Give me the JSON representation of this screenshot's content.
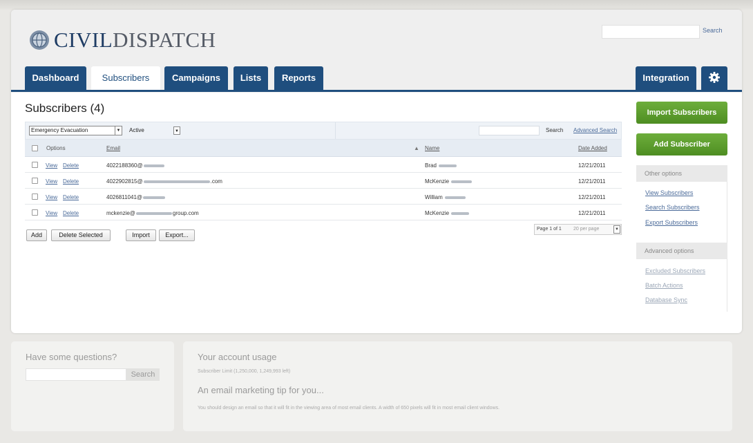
{
  "app": {
    "logo_bold": "CIVIL",
    "logo_light": "DISPATCH",
    "search_button": "Search"
  },
  "nav": {
    "tabs": [
      {
        "label": "Dashboard"
      },
      {
        "label": "Subscribers",
        "active": true
      },
      {
        "label": "Campaigns"
      },
      {
        "label": "Lists"
      },
      {
        "label": "Reports"
      }
    ],
    "integration": "Integration",
    "settings_icon": "gear-icon"
  },
  "main": {
    "title": "Subscribers (4)",
    "filter": {
      "list_value": "Emergency Evacuation",
      "status_value": "Active",
      "search_button": "Search",
      "advanced_search": "Advanced Search"
    },
    "table": {
      "headers": {
        "options": "Options",
        "email": "Email",
        "name": "Name",
        "date": "Date Added"
      },
      "view": "View",
      "delete": "Delete",
      "rows": [
        {
          "email_prefix": "4022188360@",
          "email_suffix": "",
          "name": "Brad",
          "date": "12/21/2011"
        },
        {
          "email_prefix": "4022902815@",
          "email_suffix": ".com",
          "name": "McKenzie",
          "date": "12/21/2011"
        },
        {
          "email_prefix": "4026811041@",
          "email_suffix": "",
          "name": "William",
          "date": "12/21/2011"
        },
        {
          "email_prefix": "mckenzie@",
          "email_suffix": "group.com",
          "name": "McKenzie",
          "date": "12/21/2011"
        }
      ]
    },
    "actions": {
      "add": "Add",
      "delete_selected": "Delete Selected",
      "import": "Import",
      "export": "Export..."
    },
    "pager": {
      "page": "Page 1 of 1",
      "per_page": "20 per page"
    }
  },
  "sidebar": {
    "import_button": "Import Subscribers",
    "add_button": "Add Subscriber",
    "other_options": "Other options",
    "other_links": [
      "View Subscribers",
      "Search Subscribers",
      "Export Subscribers"
    ],
    "advanced_options": "Advanced options",
    "advanced_links": [
      "Excluded Subscribers",
      "Batch Actions",
      "Database Sync"
    ]
  },
  "footer": {
    "questions_title": "Have some questions?",
    "questions_button": "Search",
    "usage_title": "Your account usage",
    "usage_text": "Subscriber Limit (1,250,000, 1,249,993 left)",
    "tip_title": "An email marketing tip for you...",
    "tip_text": "You should design an email so that it will fit in the viewing area of most email clients. A width of 650 pixels will fit in most email client windows."
  },
  "colors": {
    "brand_blue": "#1f4e7e",
    "action_green": "#5a9b2c",
    "link_blue": "#4a6a99"
  }
}
